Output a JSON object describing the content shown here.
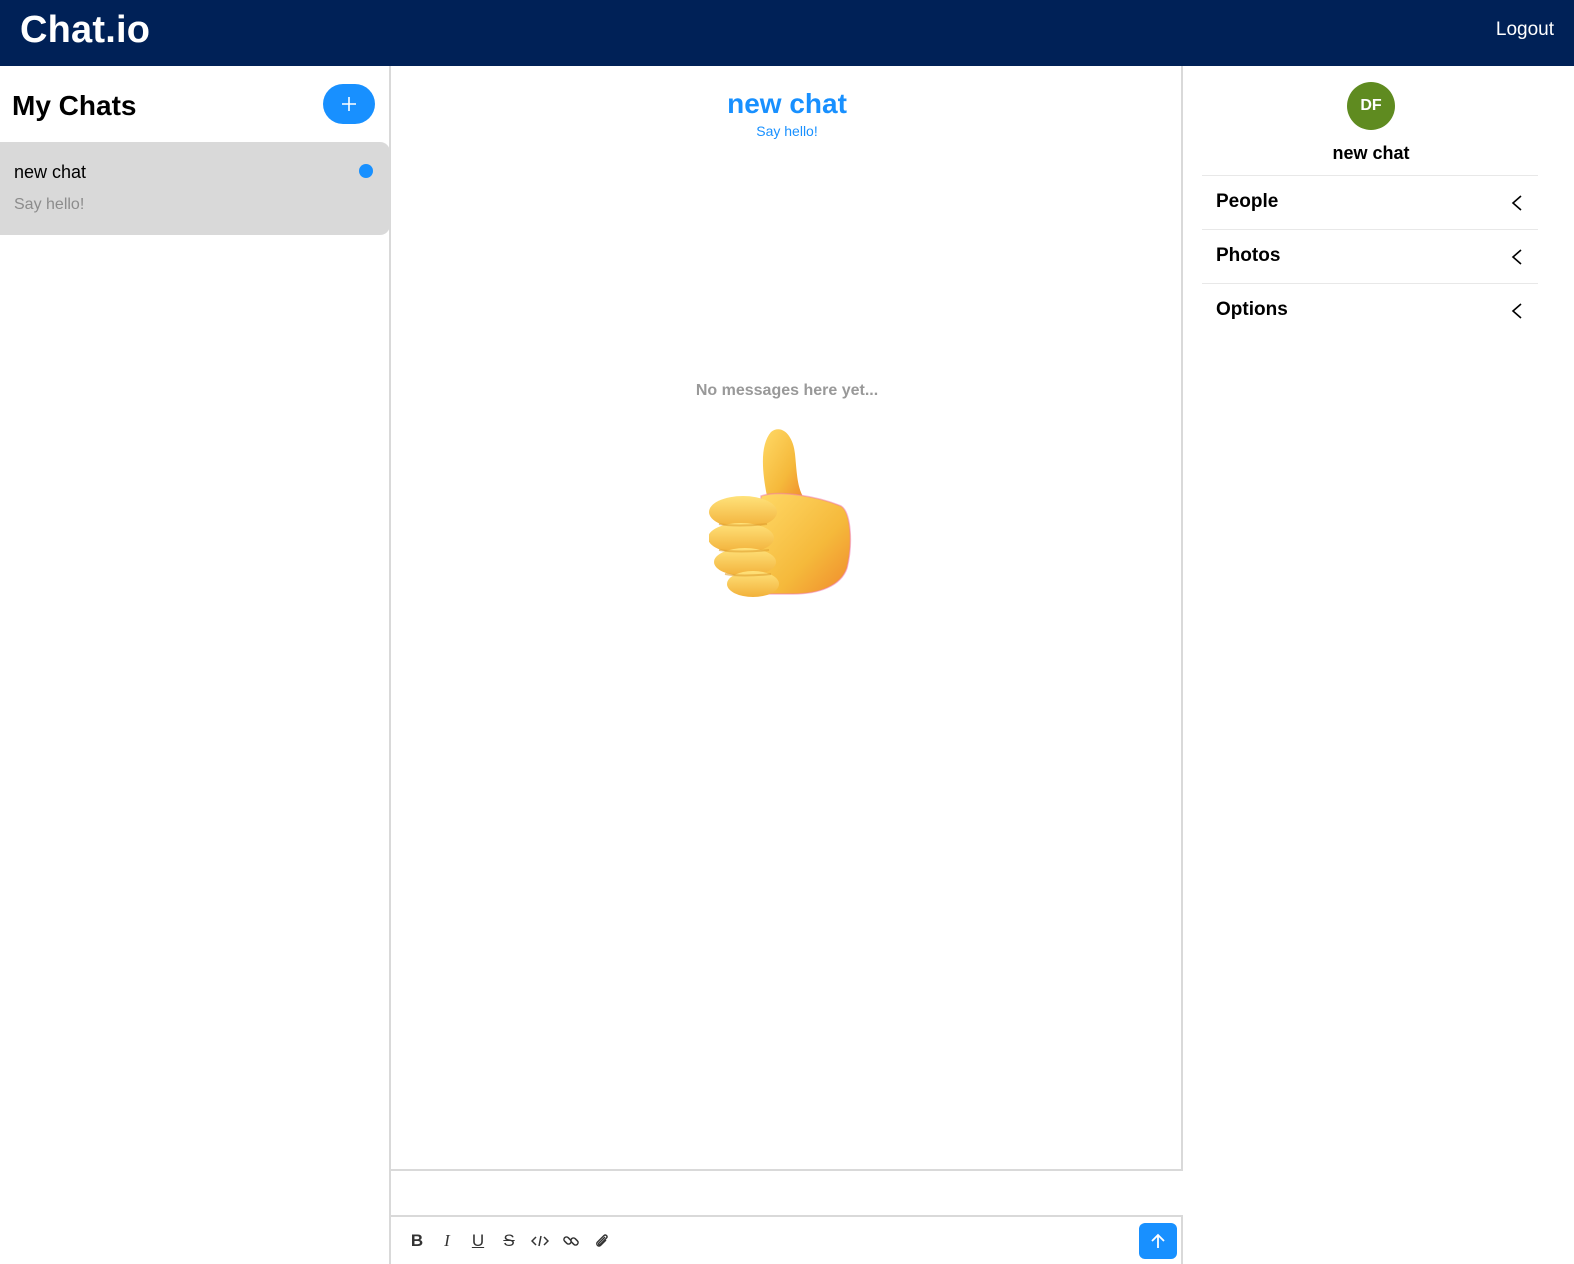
{
  "app": {
    "brand": "Chat.io",
    "logout_label": "Logout"
  },
  "sidebar": {
    "title": "My Chats",
    "add_icon": "plus-icon",
    "chats": [
      {
        "title": "new chat",
        "subtitle": "Say hello!",
        "unread": true
      }
    ]
  },
  "chat": {
    "title": "new chat",
    "subtitle": "Say hello!",
    "empty_text": "No messages here yet...",
    "empty_illustration": "thumbs-up-emoji",
    "input_value": "",
    "toolbar_icons": [
      "bold-icon",
      "italic-icon",
      "underline-icon",
      "strikethrough-icon",
      "code-icon",
      "link-icon",
      "attachment-icon"
    ],
    "send_icon": "arrow-up-icon"
  },
  "details": {
    "avatar_initials": "DF",
    "title": "new chat",
    "sections": [
      {
        "label": "People"
      },
      {
        "label": "Photos"
      },
      {
        "label": "Options"
      }
    ]
  },
  "colors": {
    "header_bg": "#002157",
    "accent": "#1890ff",
    "avatar_bg": "#5f8b20",
    "selected_chat_bg": "#d9d9d9"
  }
}
